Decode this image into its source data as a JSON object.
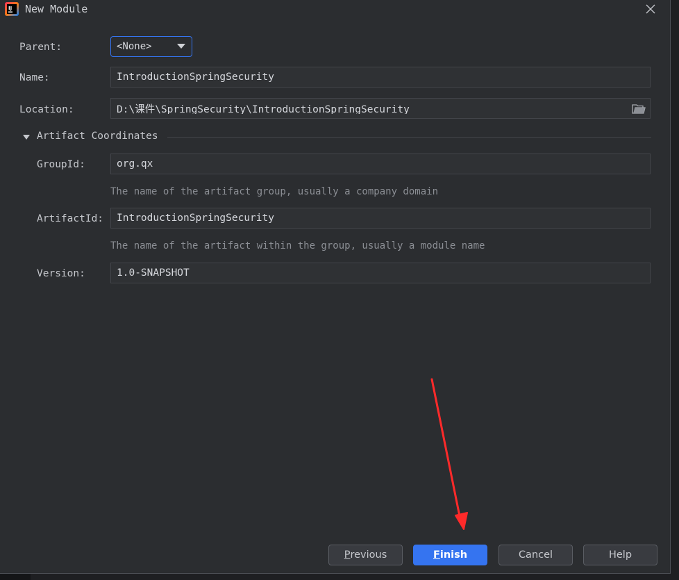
{
  "window": {
    "title": "New Module",
    "app_icon": "intellij-idea-icon",
    "close_icon": "close-icon"
  },
  "form": {
    "parent": {
      "label": "Parent:",
      "value": "<None>"
    },
    "name": {
      "label": "Name:",
      "value": "IntroductionSpringSecurity"
    },
    "location": {
      "label": "Location:",
      "value": "D:\\课件\\SpringSecurity\\IntroductionSpringSecurity",
      "icon": "folder-icon"
    }
  },
  "artifact": {
    "section_label": "Artifact Coordinates",
    "group_id": {
      "label": "GroupId:",
      "value": "org.qx",
      "hint": "The name of the artifact group, usually a company domain"
    },
    "artifact_id": {
      "label": "ArtifactId:",
      "value": "IntroductionSpringSecurity",
      "hint": "The name of the artifact within the group, usually a module name"
    },
    "version": {
      "label": "Version:",
      "value": "1.0-SNAPSHOT"
    }
  },
  "buttons": {
    "previous": {
      "mnemonic": "P",
      "rest": "revious"
    },
    "finish": {
      "mnemonic": "F",
      "rest": "inish"
    },
    "cancel": "Cancel",
    "help": "Help"
  },
  "colors": {
    "accent": "#3574f0",
    "annotation_arrow": "#ff2a2a",
    "background": "#2b2d30"
  }
}
